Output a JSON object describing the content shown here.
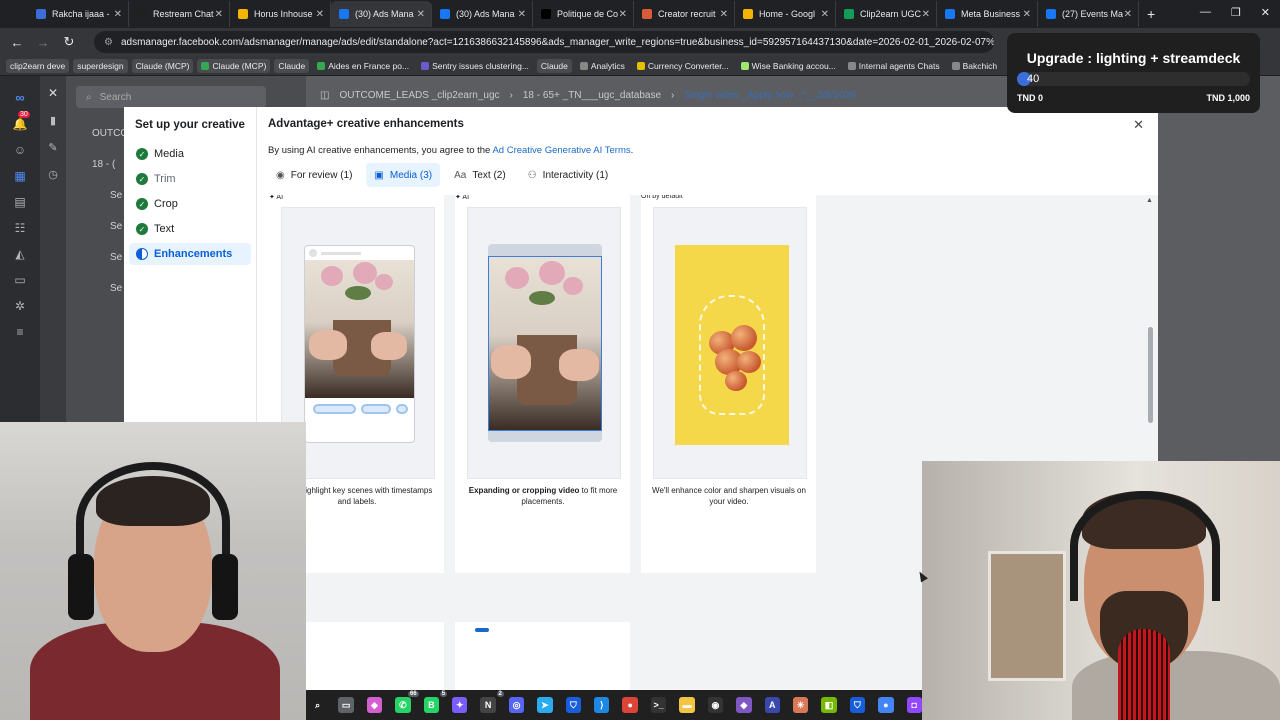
{
  "browser": {
    "tabs": [
      {
        "label": "Rakcha ijaaa -",
        "color": "#3b6ed8",
        "active": false
      },
      {
        "label": "Restream Chat",
        "color": "#202020",
        "active": false
      },
      {
        "label": "Horus Inhouse",
        "color": "#f4b400",
        "active": false
      },
      {
        "label": "(30) Ads Mana",
        "color": "#1877f2",
        "active": true
      },
      {
        "label": "(30) Ads Mana",
        "color": "#1877f2",
        "active": false
      },
      {
        "label": "Politique de Co",
        "color": "#000000",
        "active": false
      },
      {
        "label": "Creator recruit",
        "color": "#d95c3a",
        "active": false
      },
      {
        "label": "Home - Googl",
        "color": "#f4b400",
        "active": false
      },
      {
        "label": "Clip2earn UGC",
        "color": "#0f9d58",
        "active": false
      },
      {
        "label": "Meta Business",
        "color": "#1877f2",
        "active": false
      },
      {
        "label": "(27) Events Ma",
        "color": "#1877f2",
        "active": false
      }
    ],
    "url": "adsmanager.facebook.com/adsmanager/manage/ads/edit/standalone?act=1216386632145896&ads_manager_write_regions=true&business_id=592957164437130&date=2026-02-01_2026-02-07%2Cthis_week_s...",
    "bookmarks": [
      {
        "label": "clip2earn deve",
        "chip": true,
        "color": ""
      },
      {
        "label": "superdesign",
        "chip": true,
        "color": ""
      },
      {
        "label": "Claude (MCP)",
        "chip": true,
        "color": ""
      },
      {
        "label": "Claude (MCP)",
        "chip": true,
        "color": "#34a853"
      },
      {
        "label": "Claude",
        "chip": true,
        "color": ""
      },
      {
        "label": "Aides en France po...",
        "chip": false,
        "color": "#34a853"
      },
      {
        "label": "Sentry issues clustering...",
        "chip": false,
        "color": "#6a5acd"
      },
      {
        "label": "Claude",
        "chip": true,
        "color": ""
      },
      {
        "label": "Analytics",
        "chip": false,
        "color": "#888888"
      },
      {
        "label": "Currency Converter...",
        "chip": false,
        "color": "#e5c100"
      },
      {
        "label": "Wise Banking accou...",
        "chip": false,
        "color": "#9fe870"
      },
      {
        "label": "Internal agents Chats",
        "chip": false,
        "color": "#888888"
      },
      {
        "label": "Bakchich",
        "chip": false,
        "color": "#888888"
      }
    ]
  },
  "ads_manager": {
    "search_placeholder": "Search",
    "breadcrumb": [
      "OUTCOME_LEADS _clip2earn_ugc",
      "18 - 65+ _TN___ugc_database",
      "Single video _Apply now _*__2/8/2026"
    ],
    "tree": [
      "OUTCO",
      "18 - (",
      "Se",
      "Se",
      "Se",
      "Se"
    ],
    "notif_count": "30"
  },
  "dialog": {
    "sidebar_title": "Set up your creative",
    "steps": [
      {
        "label": "Media",
        "state": "done"
      },
      {
        "label": "Trim",
        "state": "muted"
      },
      {
        "label": "Crop",
        "state": "done"
      },
      {
        "label": "Text",
        "state": "done"
      },
      {
        "label": "Enhancements",
        "state": "current"
      }
    ],
    "title": "Advantage+ creative enhancements",
    "subtitle_prefix": "By using AI creative enhancements, you agree to the ",
    "subtitle_link": "Ad Creative Generative AI Terms",
    "subtitle_suffix": ".",
    "tabs": [
      {
        "label": "For review (1)",
        "icon": "eye-icon",
        "glyph": "◉",
        "active": false
      },
      {
        "label": "Media (3)",
        "icon": "image-icon",
        "glyph": "▣",
        "active": true
      },
      {
        "label": "Text (2)",
        "icon": "text-icon",
        "glyph": "Aa",
        "active": false
      },
      {
        "label": "Interactivity (1)",
        "icon": "people-icon",
        "glyph": "⚇",
        "active": false
      }
    ],
    "cards": [
      {
        "tag": "✦ AI",
        "desc_bold": "",
        "desc": "We'll highlight key scenes with timestamps and labels."
      },
      {
        "tag": "✦ AI",
        "desc_bold": "Expanding or cropping video",
        "desc": " to fit more placements."
      },
      {
        "tag": "On by default",
        "desc_bold": "",
        "desc": "We'll enhance color and sharpen visuals on your video."
      }
    ]
  },
  "goal_widget": {
    "title": "Upgrade : lighting + streamdeck",
    "current": "40",
    "progress": 0.04,
    "min_label": "TND 0",
    "max_label": "TND 1,000"
  },
  "taskbar": {
    "icons": [
      {
        "name": "search-icon",
        "glyph": "⌕",
        "color": "#202020",
        "badge": ""
      },
      {
        "name": "file-explorer-icon",
        "glyph": "▭",
        "color": "#5f6368",
        "badge": ""
      },
      {
        "name": "copilot-icon",
        "glyph": "◆",
        "color": "#d45fd0",
        "badge": ""
      },
      {
        "name": "whatsapp-icon",
        "glyph": "✆",
        "color": "#25d366",
        "badge": "66"
      },
      {
        "name": "whatsapp-business-icon",
        "glyph": "B",
        "color": "#25d366",
        "badge": "5"
      },
      {
        "name": "game-icon",
        "glyph": "✦",
        "color": "#7b5cff",
        "badge": ""
      },
      {
        "name": "notion-icon",
        "glyph": "N",
        "color": "#444444",
        "badge": "2"
      },
      {
        "name": "discord-icon",
        "glyph": "◎",
        "color": "#5865f2",
        "badge": ""
      },
      {
        "name": "telegram-icon",
        "glyph": "➤",
        "color": "#2aabee",
        "badge": ""
      },
      {
        "name": "bitwarden-icon",
        "glyph": "⛉",
        "color": "#175ddc",
        "badge": ""
      },
      {
        "name": "vscode-icon",
        "glyph": "⟩",
        "color": "#1e88e5",
        "badge": ""
      },
      {
        "name": "chrome-icon",
        "glyph": "●",
        "color": "#db4437",
        "badge": ""
      },
      {
        "name": "terminal-icon",
        "glyph": ">_",
        "color": "#333333",
        "badge": ""
      },
      {
        "name": "folder-icon",
        "glyph": "▬",
        "color": "#f4c542",
        "badge": ""
      },
      {
        "name": "github-icon",
        "glyph": "◉",
        "color": "#333333",
        "badge": ""
      },
      {
        "name": "obsidian-icon",
        "glyph": "◆",
        "color": "#7e57c2",
        "badge": ""
      },
      {
        "name": "app-icon",
        "glyph": "A",
        "color": "#3949ab",
        "badge": ""
      },
      {
        "name": "claude-icon",
        "glyph": "✳",
        "color": "#d97757",
        "badge": ""
      },
      {
        "name": "nvidia-icon",
        "glyph": "◧",
        "color": "#76b900",
        "badge": ""
      },
      {
        "name": "bitwarden2-icon",
        "glyph": "⛉",
        "color": "#175ddc",
        "badge": ""
      },
      {
        "name": "chrome2-icon",
        "glyph": "●",
        "color": "#4285f4",
        "badge": ""
      },
      {
        "name": "twitch-icon",
        "glyph": "◘",
        "color": "#9146ff",
        "badge": ""
      }
    ]
  }
}
